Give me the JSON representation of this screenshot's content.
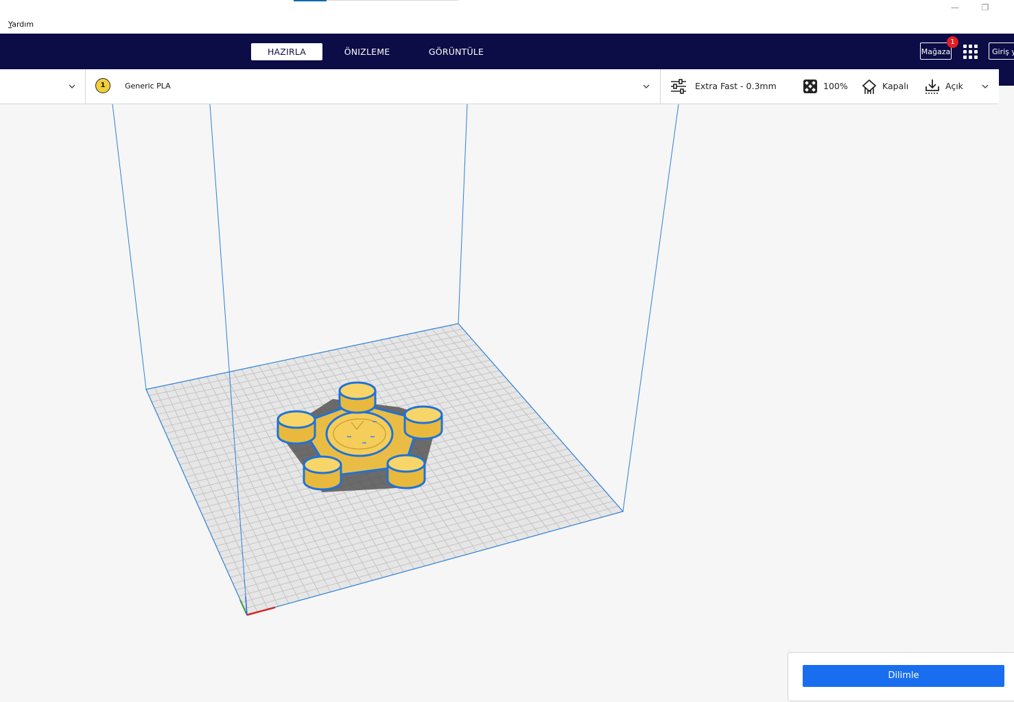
{
  "window": {
    "minimize_glyph": "—",
    "restore_glyph": "❐"
  },
  "menu": {
    "help_first": "Y",
    "help_rest": "ardım"
  },
  "stages": {
    "prepare": "HAZIRLA",
    "preview": "ÖNIZLEME",
    "monitor": "GÖRÜNTÜLE",
    "active": "prepare"
  },
  "header": {
    "marketplace_label": "Mağaza",
    "marketplace_badge": "1",
    "signin_label": "Giriş yap",
    "background_color": "#0c0c47"
  },
  "material": {
    "extruder_number": "1",
    "name": "Generic PLA",
    "color": "#f1ce3c"
  },
  "print_settings": {
    "profile": "Extra Fast - 0.3mm",
    "infill": "100%",
    "support": "Kapalı",
    "adhesion": "Açık"
  },
  "slice": {
    "button_label": "Dilimle",
    "button_color": "#196ef0"
  },
  "viewport": {
    "model_color": "#f5cd5a",
    "outline_color": "#1f72d8",
    "build_volume_color": "#2b7fd4"
  }
}
